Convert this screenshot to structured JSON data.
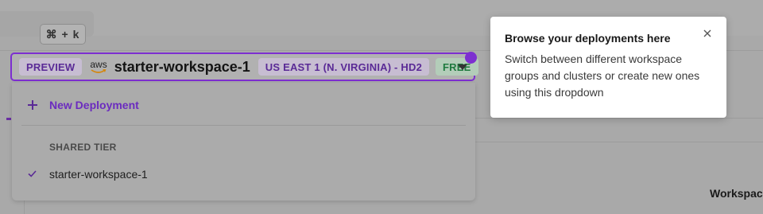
{
  "search": {
    "shortcut": "⌘ + k"
  },
  "selector": {
    "preview_badge": "PREVIEW",
    "provider": "aws",
    "workspace_name": "starter-workspace-1",
    "region_badge": "US EAST 1 (N. VIRGINIA) - HD2",
    "tier_badge": "FREE",
    "accent_color": "#7d2fd0"
  },
  "dropdown": {
    "new_deployment_label": "New Deployment",
    "section_label": "SHARED TIER",
    "items": [
      {
        "label": "starter-workspace-1",
        "selected": true
      }
    ]
  },
  "tooltip": {
    "title": "Browse your deployments here",
    "body": "Switch between different workspace groups and clusters or create new ones using this dropdown"
  },
  "background": {
    "workspace_heading": "Workspac"
  }
}
